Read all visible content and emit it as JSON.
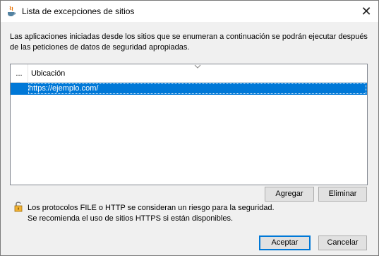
{
  "window": {
    "title": "Lista de excepciones de sitios",
    "close_glyph": "✕"
  },
  "description": "Las aplicaciones iniciadas desde los sitios que se enumeran a continuación se podrán ejecutar después de las peticiones de datos de seguridad apropiadas.",
  "table": {
    "columns": [
      "...",
      "Ubicación"
    ],
    "rows": [
      {
        "location": "https://ejemplo.com/"
      }
    ]
  },
  "buttons": {
    "add": "Agregar",
    "remove": "Eliminar",
    "ok": "Aceptar",
    "cancel": "Cancelar"
  },
  "warning": {
    "line1": "Los protocolos FILE o HTTP se consideran un riesgo para la seguridad.",
    "line2": "Se recomienda el uso de sitios HTTPS si están disponibles."
  },
  "colors": {
    "selection": "#0078d7",
    "button_face": "#e1e1e1",
    "dialog_bg": "#f0f0f0"
  },
  "icons": [
    "java-icon",
    "close-icon",
    "sort-indicator-icon",
    "lock-icon"
  ]
}
